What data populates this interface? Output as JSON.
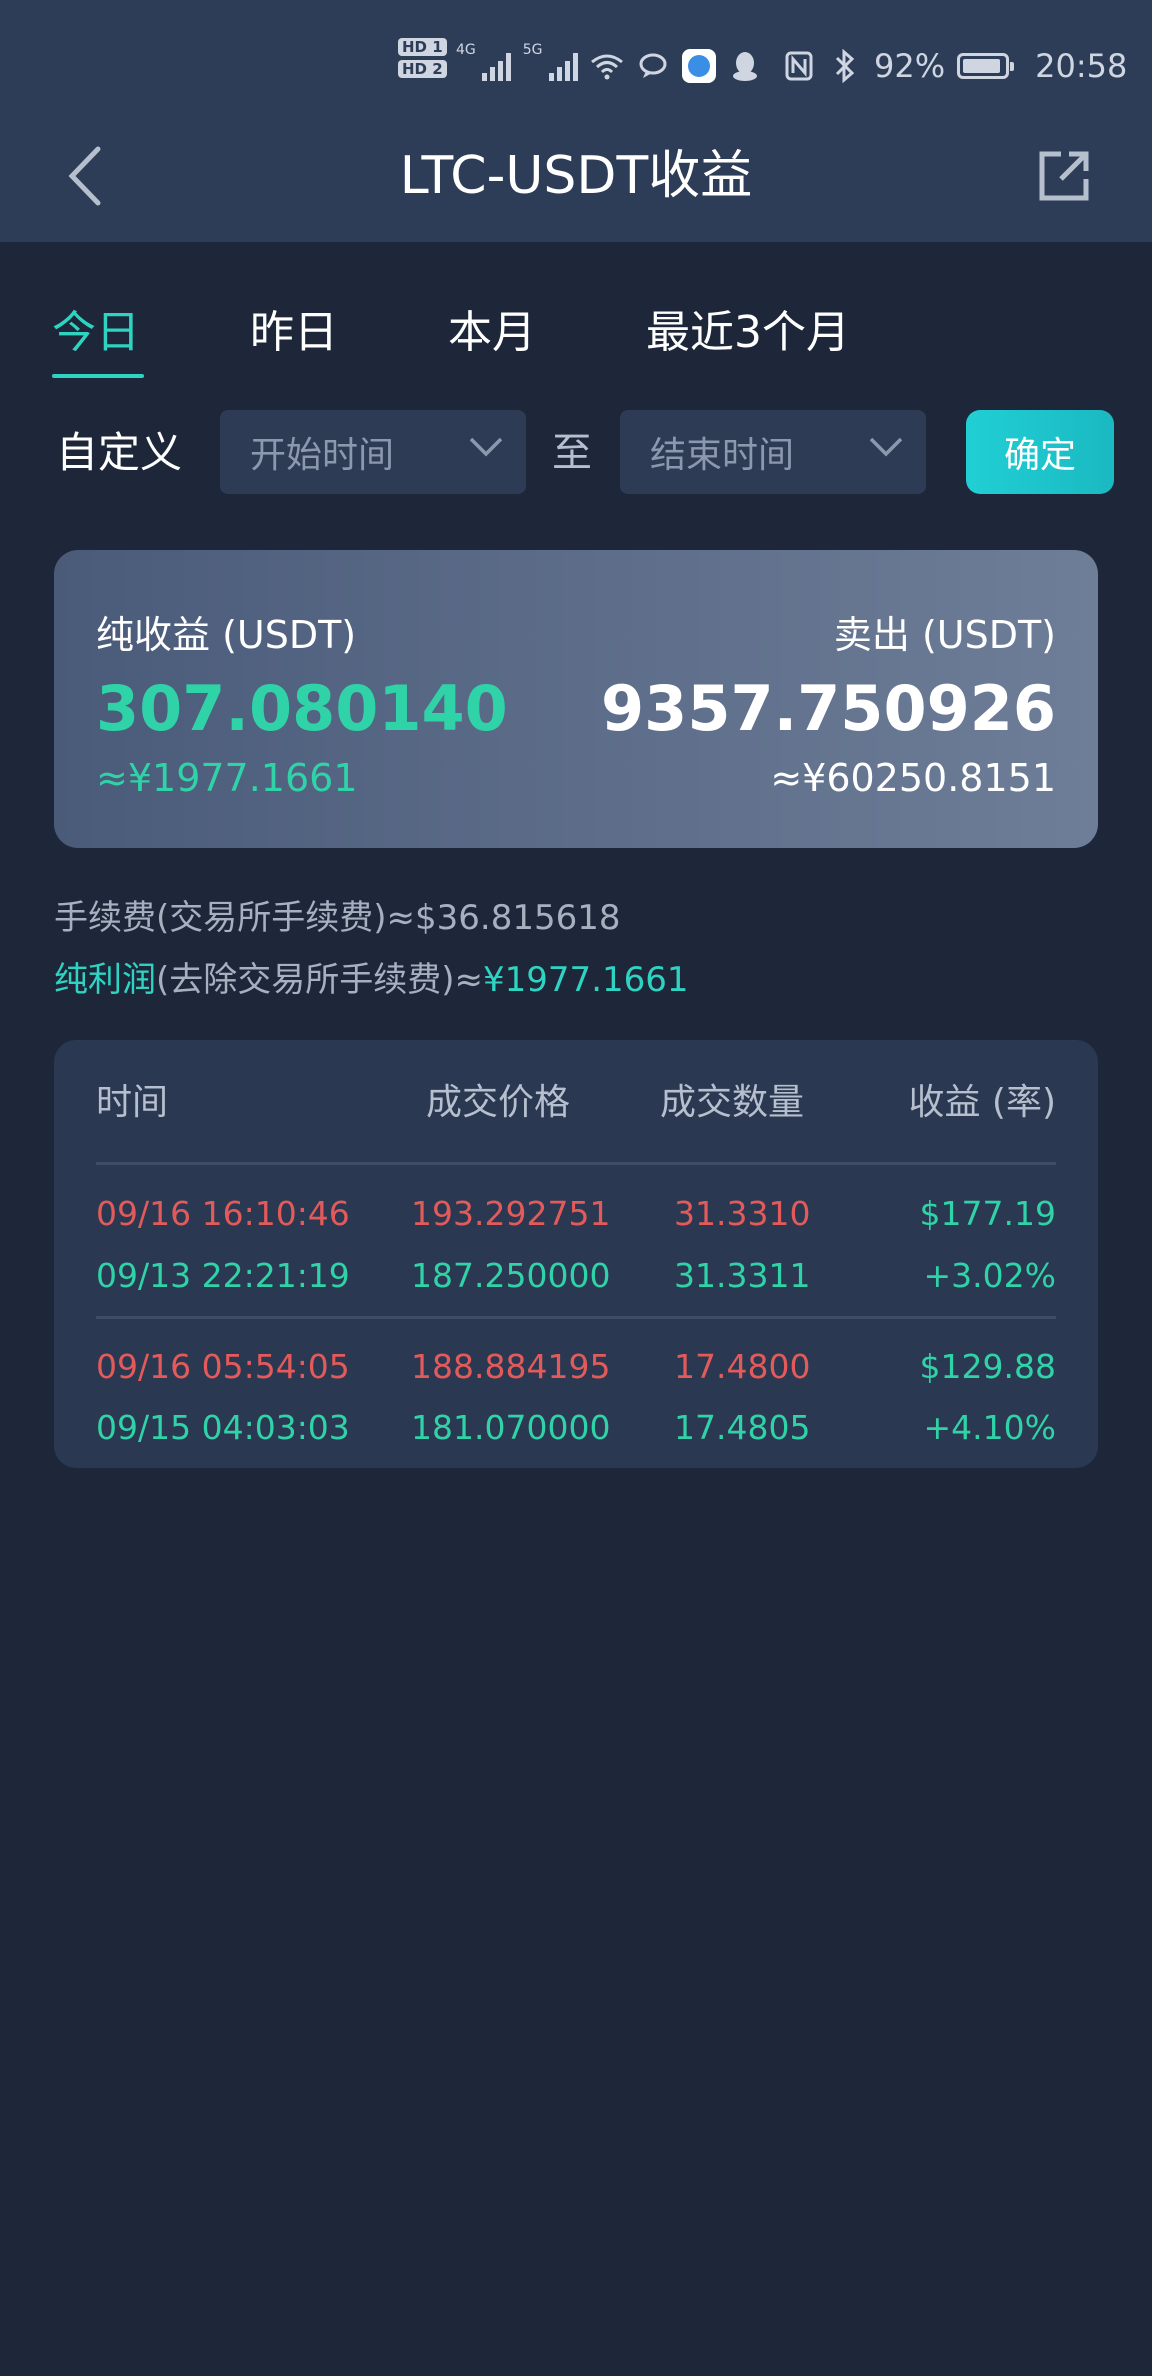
{
  "status_bar": {
    "hd1": "HD 1",
    "hd2": "HD 2",
    "net1": "4G",
    "net2": "5G",
    "battery_pct": "92%",
    "battery_level": 0.92,
    "time": "20:58"
  },
  "nav": {
    "title": "LTC-USDT收益"
  },
  "tabs": [
    {
      "label": "今日",
      "active": true
    },
    {
      "label": "昨日",
      "active": false
    },
    {
      "label": "本月",
      "active": false
    },
    {
      "label": "最近3个月",
      "active": false
    }
  ],
  "range": {
    "custom_label": "自定义",
    "start_placeholder": "开始时间",
    "to_label": "至",
    "end_placeholder": "结束时间",
    "confirm_label": "确定"
  },
  "summary": {
    "net_income_label": "纯收益 (USDT)",
    "net_income_value": "307.080140",
    "net_income_cny": "≈¥1977.1661",
    "sell_label": "卖出 (USDT)",
    "sell_value": "9357.750926",
    "sell_cny": "≈¥60250.8151"
  },
  "fees": {
    "fee_line": "手续费(交易所手续费)≈$36.815618",
    "profit_prefix": "纯利润",
    "profit_middle": "(去除交易所手续费)≈",
    "profit_value": "¥1977.1661"
  },
  "table": {
    "headers": [
      "时间",
      "成交价格",
      "成交数量",
      "收益 (率)"
    ],
    "groups": [
      {
        "sell": {
          "time": "09/16 16:10:46",
          "price": "193.292751",
          "qty": "31.3310",
          "profit": "$177.19"
        },
        "buy": {
          "time": "09/13 22:21:19",
          "price": "187.250000",
          "qty": "31.3311",
          "rate": "+3.02%"
        }
      },
      {
        "sell": {
          "time": "09/16 05:54:05",
          "price": "188.884195",
          "qty": "17.4800",
          "profit": "$129.88"
        },
        "buy": {
          "time": "09/15 04:03:03",
          "price": "181.070000",
          "qty": "17.4805",
          "rate": "+4.10%"
        }
      }
    ]
  },
  "colors": {
    "accent": "#2fd3c2",
    "profit_green": "#2fd3a7",
    "sell_red": "#e35a5a",
    "background": "#1e2739",
    "header_bg": "#2e3d57"
  }
}
